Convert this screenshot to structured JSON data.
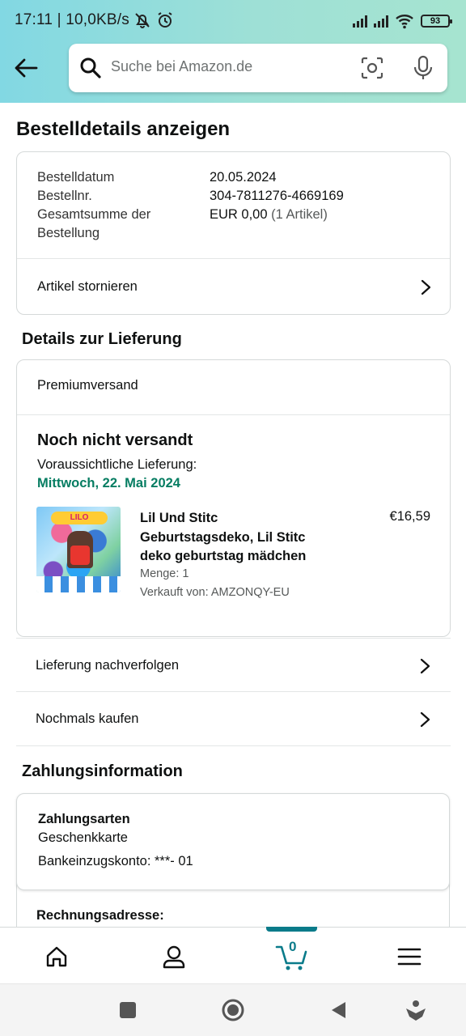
{
  "status_bar": {
    "time_speed": "17:11 | 10,0KB/s",
    "battery": "93"
  },
  "search": {
    "placeholder": "Suche bei Amazon.de"
  },
  "page_title": "Bestelldetails anzeigen",
  "order_summary": {
    "date_label": "Bestelldatum",
    "date_value": "20.05.2024",
    "number_label": "Bestellnr.",
    "number_value": "304-7811276-4669169",
    "total_label_line1": "Gesamtsumme der",
    "total_label_line2": "Bestellung",
    "total_value": "EUR 0,00",
    "total_count": "(1 Artikel)",
    "cancel_label": "Artikel stornieren"
  },
  "delivery": {
    "section_title": "Details zur Lieferung",
    "shipping_method": "Premiumversand",
    "status": "Noch nicht versandt",
    "eta_label": "Voraussichtliche Lieferung:",
    "eta_date": "Mittwoch, 22. Mai 2024",
    "product": {
      "image_banner": "LILO",
      "name_line1": "Lil Und Stitc",
      "name_line2": "Geburtstagsdeko, Lil Stitc",
      "name_line3": "deko geburtstag mädchen",
      "price": "€16,59",
      "quantity": "Menge: 1",
      "seller": "Verkauft von: AMZONQY-EU"
    },
    "track_label": "Lieferung nachverfolgen",
    "buy_again_label": "Nochmals kaufen"
  },
  "payment": {
    "section_title": "Zahlungsinformation",
    "methods_heading": "Zahlungsarten",
    "method": "Geschenkkarte",
    "account": "Bankeinzugskonto: ***- 01",
    "billing_heading": "Rechnungsadresse:"
  },
  "bottom_nav": {
    "cart_count": "0"
  },
  "colors": {
    "header_gradient_start": "#82d8e3",
    "header_gradient_end": "#a6e4d0",
    "eta_green": "#067d62",
    "nav_active": "#0a7b8a"
  }
}
